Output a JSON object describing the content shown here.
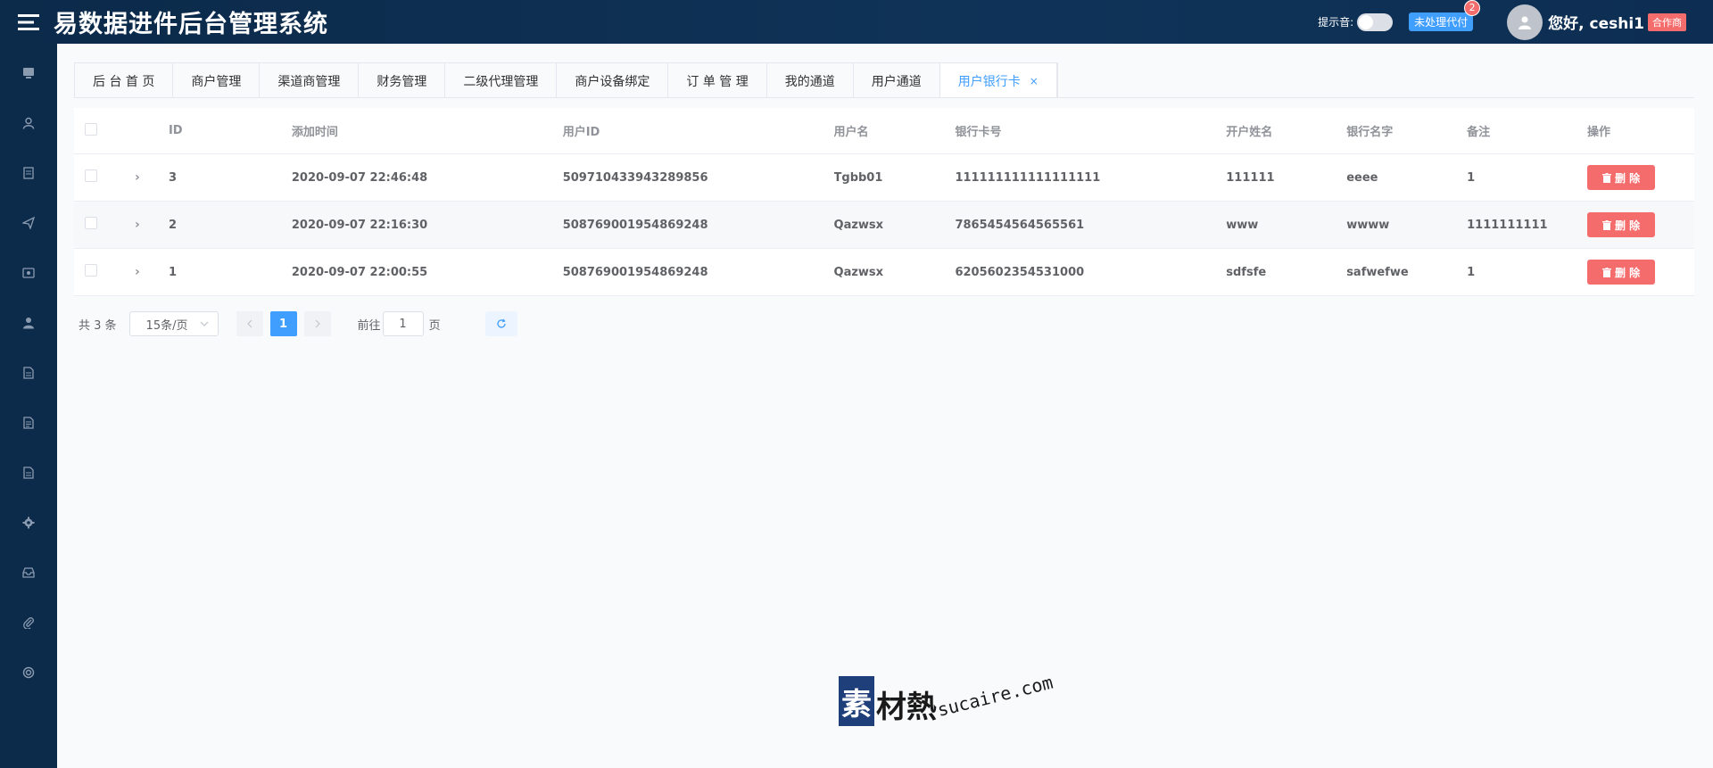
{
  "header": {
    "title": "易数据进件后台管理系统",
    "sound_label": "提示音:",
    "pending_label": "未处理代付",
    "pending_count": "2",
    "greeting": "您好, ceshi1",
    "role": "合作商"
  },
  "sidebar": {
    "items": [
      {
        "icon": "monitor-icon"
      },
      {
        "icon": "user-icon"
      },
      {
        "icon": "document-icon"
      },
      {
        "icon": "send-icon"
      },
      {
        "icon": "card-icon"
      },
      {
        "icon": "person-icon"
      },
      {
        "icon": "file-icon"
      },
      {
        "icon": "file-text-icon"
      },
      {
        "icon": "file-list-icon"
      },
      {
        "icon": "gear-icon"
      },
      {
        "icon": "inbox-icon"
      },
      {
        "icon": "paperclip-icon"
      },
      {
        "icon": "lifebuoy-icon"
      }
    ]
  },
  "tabs": [
    {
      "label": "后 台 首 页"
    },
    {
      "label": "商户管理"
    },
    {
      "label": "渠道商管理"
    },
    {
      "label": "财务管理"
    },
    {
      "label": "二级代理管理"
    },
    {
      "label": "商户设备绑定"
    },
    {
      "label": "订 单 管 理"
    },
    {
      "label": "我的通道"
    },
    {
      "label": "用户通道"
    },
    {
      "label": "用户银行卡",
      "active": true,
      "close": "×"
    }
  ],
  "table": {
    "columns": [
      "ID",
      "添加时间",
      "用户ID",
      "用户名",
      "银行卡号",
      "开户姓名",
      "银行名字",
      "备注",
      "操作"
    ],
    "rows": [
      {
        "id": "3",
        "time": "2020-09-07 22:46:48",
        "uid": "509710433943289856",
        "name": "Tgbb01",
        "card": "111111111111111111",
        "holder": "111111",
        "bank": "eeee",
        "remark": "1",
        "action": "删 除"
      },
      {
        "id": "2",
        "time": "2020-09-07 22:16:30",
        "uid": "508769001954869248",
        "name": "Qazwsx",
        "card": "7865454564565561",
        "holder": "www",
        "bank": "wwww",
        "remark": "1111111111",
        "action": "删 除"
      },
      {
        "id": "1",
        "time": "2020-09-07 22:00:55",
        "uid": "508769001954869248",
        "name": "Qazwsx",
        "card": "6205602354531000",
        "holder": "sdfsfe",
        "bank": "safwefwe",
        "remark": "1",
        "action": "删 除"
      }
    ]
  },
  "pagination": {
    "total": "共 3 条",
    "page_size": "15条/页",
    "current_page": "1",
    "goto_prefix": "前往",
    "goto_value": "1",
    "goto_suffix": "页"
  },
  "watermark": {
    "mark": "素",
    "text": "材熱",
    "url": "sucaire.com"
  },
  "colors": {
    "topbar": "#0c2a4a",
    "accent": "#409eff",
    "danger": "#f56c6c"
  }
}
